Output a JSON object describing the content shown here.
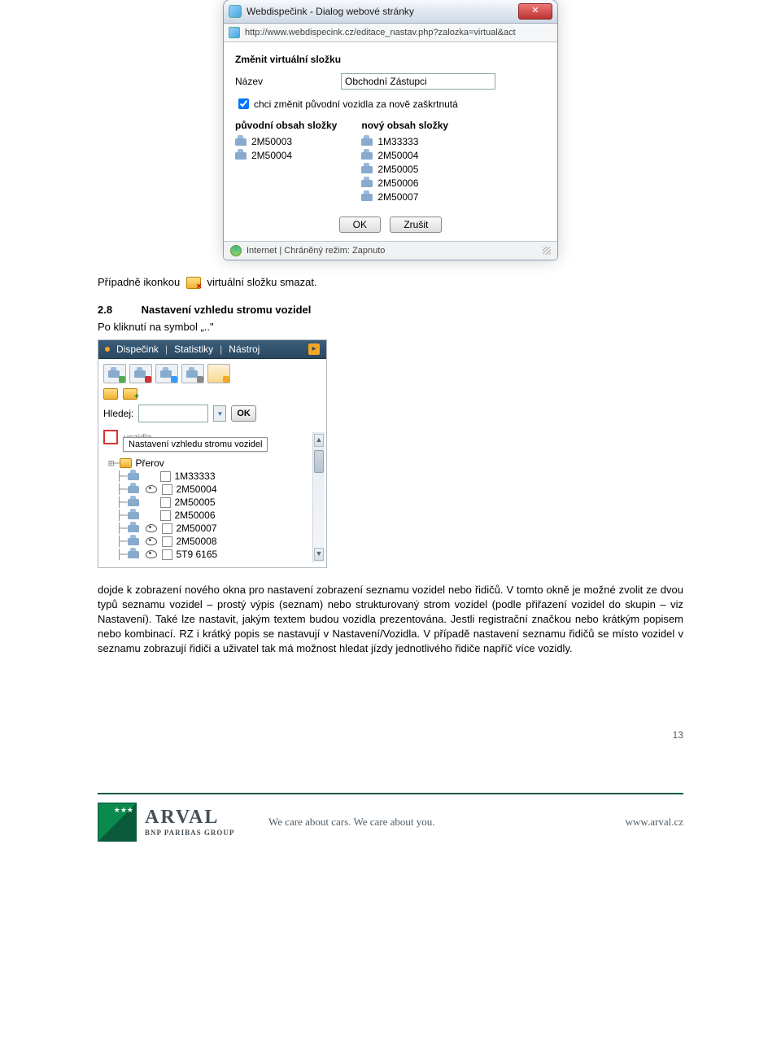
{
  "dialog": {
    "title": "Webdispečink - Dialog webové stránky",
    "url": "http://www.webdispecink.cz/editace_nastav.php?zalozka=virtual&act",
    "heading": "Změnit virtuální složku",
    "name_label": "Název",
    "name_value": "Obchodní Zástupci",
    "checkbox_label": "chci změnit původní vozidla za nově zaškrtnutá",
    "col1_header": "původní obsah složky",
    "col2_header": "nový obsah složky",
    "col1_items": [
      "2M50003",
      "2M50004"
    ],
    "col2_items": [
      "1M33333",
      "2M50004",
      "2M50005",
      "2M50006",
      "2M50007"
    ],
    "ok": "OK",
    "cancel": "Zrušit",
    "status": "Internet | Chráněný režim: Zapnuto"
  },
  "text": {
    "line1a": "Případně ikonkou",
    "line1b": "virtuální složku smazat.",
    "sec_num": "2.8",
    "sec_title": "Nastavení vzhledu stromu vozidel",
    "sec_sub": "Po kliknutí na symbol „..\"",
    "paragraph": "dojde k zobrazení nového okna pro nastavení zobrazení seznamu vozidel nebo řidičů. V tomto okně je možné zvolit ze dvou typů seznamu vozidel – prostý výpis (seznam) nebo strukturovaný strom vozidel (podle přiřazení vozidel do skupin – viz Nastavení). Také lze nastavit, jakým textem budou vozidla prezentována. Jestli registrační značkou nebo krátkým popisem nebo kombinací. RZ i krátký popis se nastavují v Nastavení/Vozidla. V případě nastavení seznamu řidičů se místo vozidel v seznamu zobrazují řidiči a uživatel tak má možnost hledat jízdy jednotlivého řidiče napříč více vozidly."
  },
  "tree": {
    "tabs": [
      "Dispečink",
      "Statistiky",
      "Nástroj"
    ],
    "folder_label": "",
    "search_label": "Hledej:",
    "search_value": "",
    "ok": "OK",
    "tooltip": "Nastavení vzhledu stromu vozidel",
    "vozidla_label": "vozidla",
    "prerov": "Přerov",
    "items": [
      "1M33333",
      "2M50004",
      "2M50005",
      "2M50006",
      "2M50007",
      "2M50008",
      "5T9 6165"
    ],
    "eyes": [
      false,
      true,
      false,
      false,
      true,
      true,
      true
    ]
  },
  "footer": {
    "page": "13",
    "brand_name": "ARVAL",
    "brand_group": "BNP PARIBAS GROUP",
    "slogan": "We care about cars. We care about you.",
    "site": "www.arval.cz"
  }
}
